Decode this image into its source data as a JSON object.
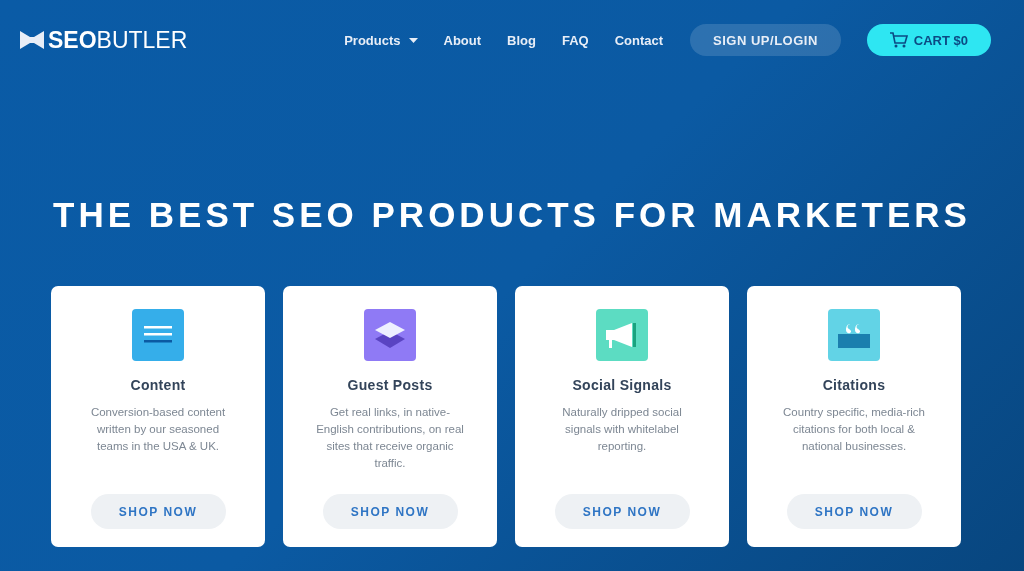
{
  "header": {
    "logo": "**SEO**BUTLER",
    "nav": [
      {
        "label": "Products",
        "dropdown": true
      },
      {
        "label": "About",
        "dropdown": false
      },
      {
        "label": "Blog",
        "dropdown": false
      },
      {
        "label": "FAQ",
        "dropdown": false
      },
      {
        "label": "Contact",
        "dropdown": false
      }
    ],
    "login": "SIGN UP/LOGIN",
    "cart": "CART $0"
  },
  "hero": {
    "title": "THE BEST SEO PRODUCTS FOR MARKETERS"
  },
  "products": [
    {
      "name": "Content",
      "description": "Conversion-based content written by our seasoned teams in the USA & UK.",
      "button": "SHOP NOW",
      "color": "#35aeea"
    },
    {
      "name": "Guest Posts",
      "description": "Get real links, in native-English contributions, on real sites that receive organic traffic.",
      "button": "SHOP NOW",
      "color": "#8f7af5"
    },
    {
      "name": "Social Signals",
      "description": "Naturally dripped social signals with whitelabel reporting.",
      "button": "SHOP NOW",
      "color": "#5cdcc2"
    },
    {
      "name": "Citations",
      "description": "Country specific, media-rich citations for both local & national businesses.",
      "button": "SHOP NOW",
      "color": "#62d3e6"
    }
  ]
}
